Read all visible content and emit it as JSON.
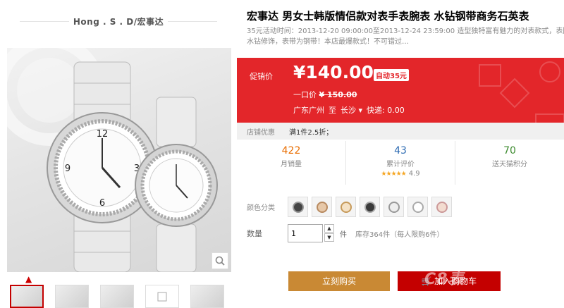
{
  "brand": {
    "name": "Hong . S . D/宏事达"
  },
  "product": {
    "title": "宏事达 男女士韩版情侣款对表手表腕表 水钻钢带商务石英表",
    "subtitle": "35元活动时间：2013-12-20 09:00:00至2013-12-24 23:59:00 造型独特富有魅力的对表款式，表圈水钻修饰，表带为钢带！本店最爆款式！不可错过…"
  },
  "price": {
    "promo_label": "促销价",
    "promo_price": "¥140.00",
    "badge": "自动35元",
    "orig_label": "一口价",
    "orig_price": "¥ 150.00",
    "ship_from": "广东广州",
    "ship_to_label": "至",
    "ship_to": "长沙",
    "ship_fee": "快递: 0.00"
  },
  "shop": {
    "label": "店铺优惠",
    "promo": "满1件2.5折；"
  },
  "stats": {
    "sales": "422",
    "sales_label": "月销量",
    "reviews": "43",
    "reviews_label": "累计评价",
    "rating": "4.9",
    "stars": "★★★★★",
    "points": "70",
    "points_label": "送天猫积分"
  },
  "color_label": "颜色分类",
  "quantity": {
    "label": "数量",
    "value": "1",
    "unit": "件",
    "stock": "库存364件（每人限购6件）"
  },
  "buttons": {
    "buy": "立刻购买",
    "cart": "加入购物车"
  },
  "watermark": "C8表"
}
